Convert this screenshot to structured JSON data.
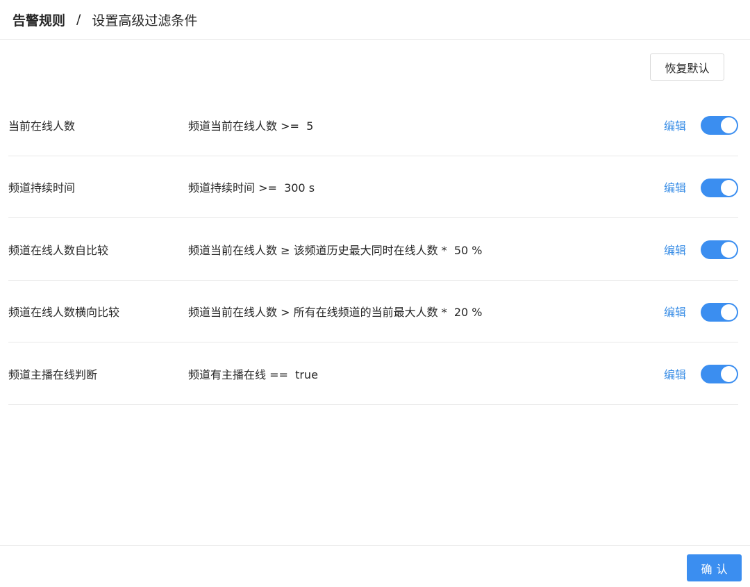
{
  "breadcrumb": {
    "root": "告警规则",
    "separator": "/",
    "current": "设置高级过滤条件"
  },
  "actions": {
    "restore_label": "恢复默认",
    "confirm_label": "确认"
  },
  "rules": [
    {
      "name": "当前在线人数",
      "condition": "频道当前在线人数 >=  5",
      "edit_label": "编辑",
      "enabled": true
    },
    {
      "name": "频道持续时间",
      "condition": "频道持续时间 >=  300 s",
      "edit_label": "编辑",
      "enabled": true
    },
    {
      "name": "频道在线人数自比较",
      "condition": "频道当前在线人数 ≥ 该频道历史最大同时在线人数 *  50 %",
      "edit_label": "编辑",
      "enabled": true
    },
    {
      "name": "频道在线人数横向比较",
      "condition": "频道当前在线人数 > 所有在线频道的当前最大人数 *  20 %",
      "edit_label": "编辑",
      "enabled": true
    },
    {
      "name": "频道主播在线判断",
      "condition": "频道有主播在线 ==  true",
      "edit_label": "编辑",
      "enabled": true
    }
  ],
  "colors": {
    "accent": "#3b8ef0",
    "link": "#3a8ee6",
    "divider": "#e8e8e8"
  }
}
